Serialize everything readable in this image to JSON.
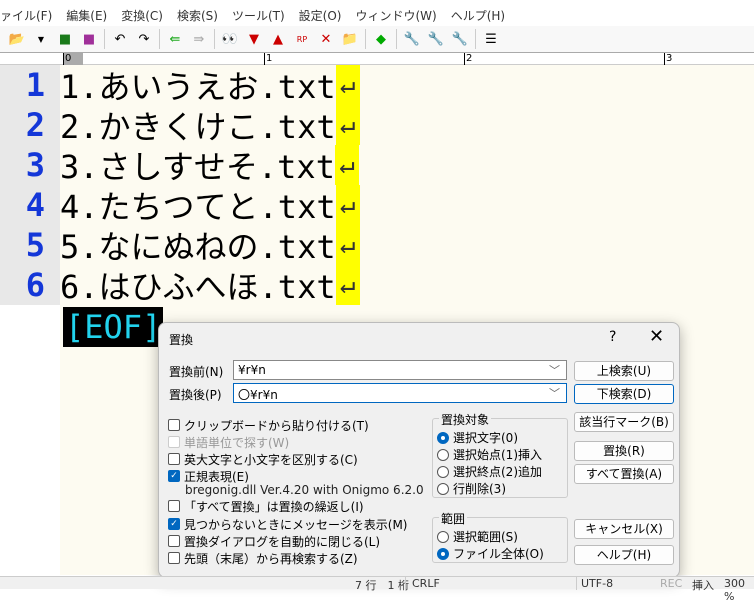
{
  "menu": [
    "ァイル(F)",
    "編集(E)",
    "変換(C)",
    "検索(S)",
    "ツール(T)",
    "設定(O)",
    "ウィンドウ(W)",
    "ヘルプ(H)"
  ],
  "ruler": [
    "0",
    "1",
    "2",
    "3"
  ],
  "lines": [
    {
      "no": "1",
      "text": "1.あいうえお.txt"
    },
    {
      "no": "2",
      "text": "2.かきくけこ.txt"
    },
    {
      "no": "3",
      "text": "3.さしすせそ.txt"
    },
    {
      "no": "4",
      "text": "4.たちつてと.txt"
    },
    {
      "no": "5",
      "text": "5.なにぬねの.txt"
    },
    {
      "no": "6",
      "text": "6.はひふへほ.txt"
    }
  ],
  "return_glyph": "↵",
  "eof": "[EOF]",
  "dialog": {
    "title": "置換",
    "help": "?",
    "close": "✕",
    "find_label": "置換前(N)",
    "find_value": "¥r¥n",
    "replace_label": "置換後(P)",
    "replace_value": "〇¥r¥n",
    "buttons": {
      "up": "上検索(U)",
      "down": "下検索(D)",
      "mark": "該当行マーク(B)",
      "replace": "置換(R)",
      "replace_all": "すべて置換(A)",
      "cancel": "キャンセル(X)",
      "help": "ヘルプ(H)"
    },
    "options": [
      {
        "label": "クリップボードから貼り付ける(T)",
        "checked": false,
        "disabled": false
      },
      {
        "label": "単語単位で探す(W)",
        "checked": false,
        "disabled": true
      },
      {
        "label": "英大文字と小文字を区別する(C)",
        "checked": false,
        "disabled": false
      },
      {
        "label": "正規表現(E)",
        "checked": true,
        "disabled": false
      }
    ],
    "regex_lib": "bregonig.dll Ver.4.20 with Onigmo 6.2.0",
    "options2": [
      {
        "label": "「すべて置換」は置換の繰返し(I)",
        "checked": false
      },
      {
        "label": "見つからないときにメッセージを表示(M)",
        "checked": true
      },
      {
        "label": "置換ダイアログを自動的に閉じる(L)",
        "checked": false
      },
      {
        "label": "先頭（末尾）から再検索する(Z)",
        "checked": false
      }
    ],
    "target_group": "置換対象",
    "targets": [
      "選択文字(0)",
      "選択始点(1)挿入",
      "選択終点(2)追加",
      "行削除(3)"
    ],
    "target_selected": 0,
    "range_group": "範囲",
    "ranges": [
      "選択範囲(S)",
      "ファイル全体(O)"
    ],
    "range_selected": 1
  },
  "status": {
    "pos": "7 行　1 桁",
    "eol": "CRLF",
    "enc": "UTF-8",
    "rec": "REC",
    "mode": "挿入",
    "zoom": "300 %"
  }
}
